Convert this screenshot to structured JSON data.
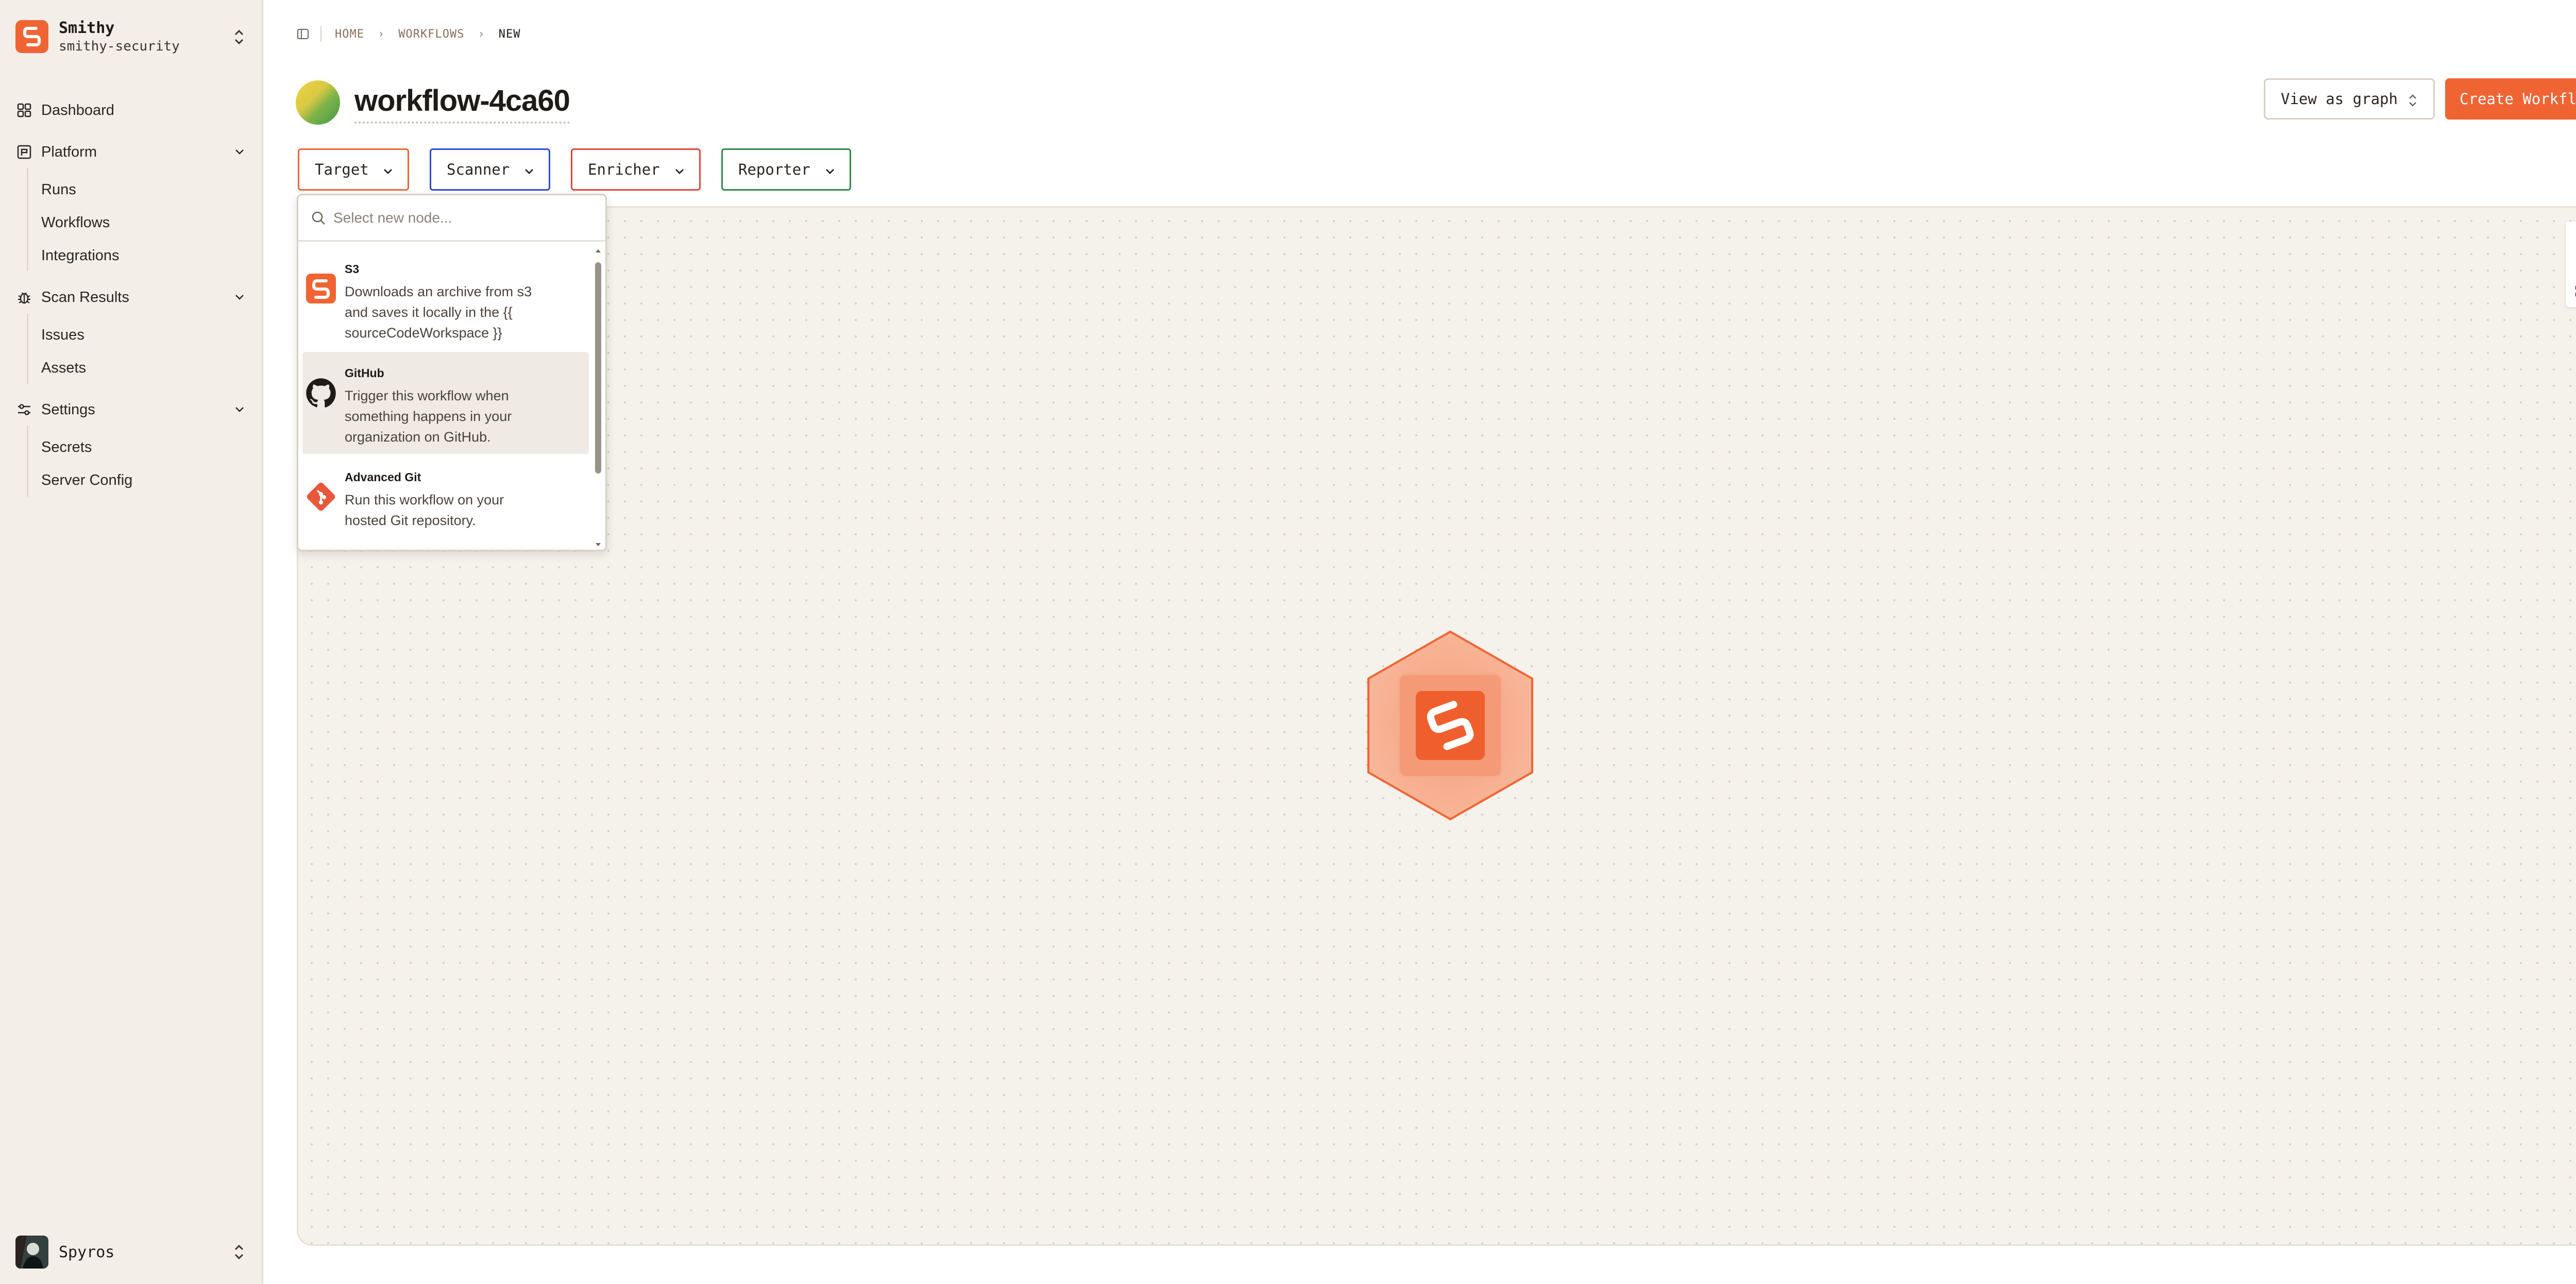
{
  "org": {
    "name": "Smithy",
    "slug": "smithy-security"
  },
  "nav": {
    "dashboard": "Dashboard",
    "platform": {
      "label": "Platform",
      "items": [
        "Runs",
        "Workflows",
        "Integrations"
      ]
    },
    "scan_results": {
      "label": "Scan Results",
      "items": [
        "Issues",
        "Assets"
      ]
    },
    "settings": {
      "label": "Settings",
      "items": [
        "Secrets",
        "Server Config"
      ]
    }
  },
  "user": {
    "name": "Spyros"
  },
  "breadcrumb": [
    "HOME",
    "WORKFLOWS",
    "NEW"
  ],
  "workflow": {
    "title": "workflow-4ca60"
  },
  "actions": {
    "view_graph": "View as graph",
    "create": "Create Workflow"
  },
  "node_types": {
    "target": "Target",
    "scanner": "Scanner",
    "enricher": "Enricher",
    "reporter": "Reporter"
  },
  "colors": {
    "accent": "#f06434",
    "target_border": "#f06434",
    "scanner_border": "#2b4bd6",
    "enricher_border": "#e0453a",
    "reporter_border": "#2f8a4a"
  },
  "dropdown": {
    "placeholder": "Select new node...",
    "items": [
      {
        "title": "S3",
        "desc": "Downloads an archive from s3 and saves it locally in the {{ sourceCodeWorkspace }}",
        "icon": "smithy-icon"
      },
      {
        "title": "GitHub",
        "desc": "Trigger this workflow when something happens in your organization on GitHub.",
        "icon": "github-icon"
      },
      {
        "title": "Advanced Git",
        "desc": "Run this workflow on your hosted Git repository.",
        "icon": "git-icon"
      }
    ]
  },
  "zoom": {
    "in": "+",
    "out": "-"
  }
}
